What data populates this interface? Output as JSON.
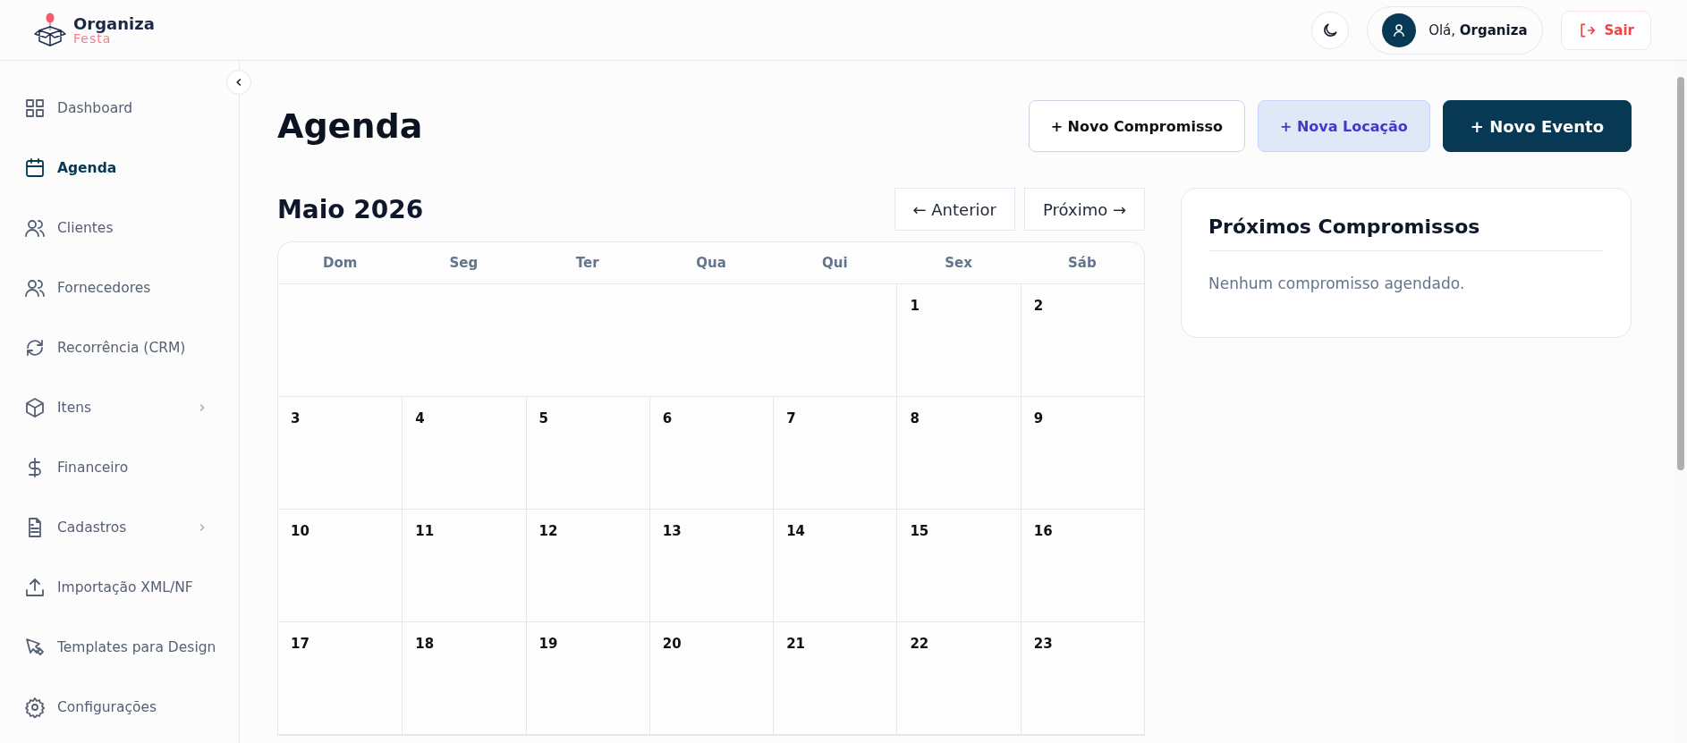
{
  "header": {
    "logo": {
      "name": "Organiza",
      "tagline": "Festa"
    },
    "greeting": {
      "prefix": "Olá, ",
      "name": "Organiza"
    },
    "logout": "Sair"
  },
  "sidebar": {
    "items": [
      {
        "label": "Dashboard",
        "selected": false,
        "submenu": false
      },
      {
        "label": "Agenda",
        "selected": true,
        "submenu": false
      },
      {
        "label": "Clientes",
        "selected": false,
        "submenu": false
      },
      {
        "label": "Fornecedores",
        "selected": false,
        "submenu": false
      },
      {
        "label": "Recorrência (CRM)",
        "selected": false,
        "submenu": false
      },
      {
        "label": "Itens",
        "selected": false,
        "submenu": true
      },
      {
        "label": "Financeiro",
        "selected": false,
        "submenu": false
      },
      {
        "label": "Cadastros",
        "selected": false,
        "submenu": true
      },
      {
        "label": "Importação XML/NF",
        "selected": false,
        "submenu": false
      },
      {
        "label": "Templates para Design",
        "selected": false,
        "submenu": false
      },
      {
        "label": "Configurações",
        "selected": false,
        "submenu": false
      }
    ]
  },
  "page": {
    "title": "Agenda",
    "actions": [
      {
        "label": "+ Novo Compromisso",
        "kind": "outline"
      },
      {
        "label": "+ Nova Locação",
        "kind": "soft"
      },
      {
        "label": "+ Novo Evento",
        "kind": "primary"
      }
    ]
  },
  "calendar": {
    "month": "Maio 2026",
    "prev": "← Anterior",
    "next": "Próximo →",
    "weekdays": [
      "Dom",
      "Seg",
      "Ter",
      "Qua",
      "Qui",
      "Sex",
      "Sáb"
    ],
    "weeks": [
      [
        "1",
        "2"
      ],
      [
        "3",
        "4",
        "5",
        "6",
        "7",
        "8",
        "9"
      ],
      [
        "10",
        "11",
        "12",
        "13",
        "14",
        "15",
        "16"
      ],
      [
        "17",
        "18",
        "19",
        "20",
        "21",
        "22",
        "23"
      ]
    ]
  },
  "upcoming": {
    "title": "Próximos Compromissos",
    "empty": "Nenhum compromisso agendado."
  }
}
